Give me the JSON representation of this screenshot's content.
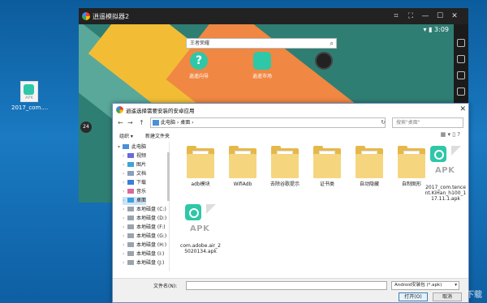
{
  "desktop": {
    "icon_label": "2017_com....",
    "icon_text": "APK"
  },
  "emulator": {
    "title": "逍遥模拟器2",
    "window_controls": [
      "⌗",
      "⛶",
      "—",
      "☐",
      "✕"
    ],
    "status_time": "3:09",
    "search_placeholder": "王者荣耀",
    "apps": [
      {
        "label": "逍遥向导"
      },
      {
        "label": "逍遥市场"
      },
      {
        "label": ""
      }
    ],
    "side_badge": "24"
  },
  "dialog": {
    "title": "逍遥选择需要安装的安卓应用",
    "close": "✕",
    "nav": {
      "back": "←",
      "forward": "→",
      "up": "↑"
    },
    "address": "此电脑 › 桌面 ›",
    "refresh": "↻",
    "search_placeholder": "搜索\"桌面\"",
    "toolbar": {
      "organize": "组织 ▾",
      "new_folder": "新建文件夹"
    },
    "tree": [
      {
        "label": "此电脑",
        "icon": "computer-icon"
      },
      {
        "label": "视频",
        "icon": "video-icon"
      },
      {
        "label": "图片",
        "icon": "picture-icon"
      },
      {
        "label": "文档",
        "icon": "document-icon"
      },
      {
        "label": "下载",
        "icon": "download-icon"
      },
      {
        "label": "音乐",
        "icon": "music-icon"
      },
      {
        "label": "桌面",
        "icon": "desktop-icon"
      },
      {
        "label": "本地磁盘 (C:)",
        "icon": "drive-icon"
      },
      {
        "label": "本地磁盘 (D:)",
        "icon": "drive-icon"
      },
      {
        "label": "本地磁盘 (F:)",
        "icon": "drive-icon"
      },
      {
        "label": "本地磁盘 (G:)",
        "icon": "drive-icon"
      },
      {
        "label": "本地磁盘 (H:)",
        "icon": "drive-icon"
      },
      {
        "label": "本地磁盘 (I:)",
        "icon": "drive-icon"
      },
      {
        "label": "本地磁盘 (J:)",
        "icon": "drive-icon"
      }
    ],
    "files": [
      {
        "label": "adb模块",
        "type": "folder"
      },
      {
        "label": "WifiAdb",
        "type": "folder"
      },
      {
        "label": "去除谷歌提示",
        "type": "folder"
      },
      {
        "label": "证书类",
        "type": "folder"
      },
      {
        "label": "自动隐藏",
        "type": "folder"
      },
      {
        "label": "自制图形",
        "type": "folder"
      },
      {
        "label": "2017_com.tencent.KiHan_h100_117.11.1.apk",
        "type": "apk",
        "icon_text": "APK"
      },
      {
        "label": "com.adobe.air_25020134.apk",
        "type": "apk",
        "icon_text": "APK"
      }
    ],
    "filename_label": "文件名(N):",
    "filename_value": "",
    "filter": "Android安装包 (*.apk)",
    "open": "打开(O)",
    "cancel": "取消"
  },
  "watermark": "下载"
}
